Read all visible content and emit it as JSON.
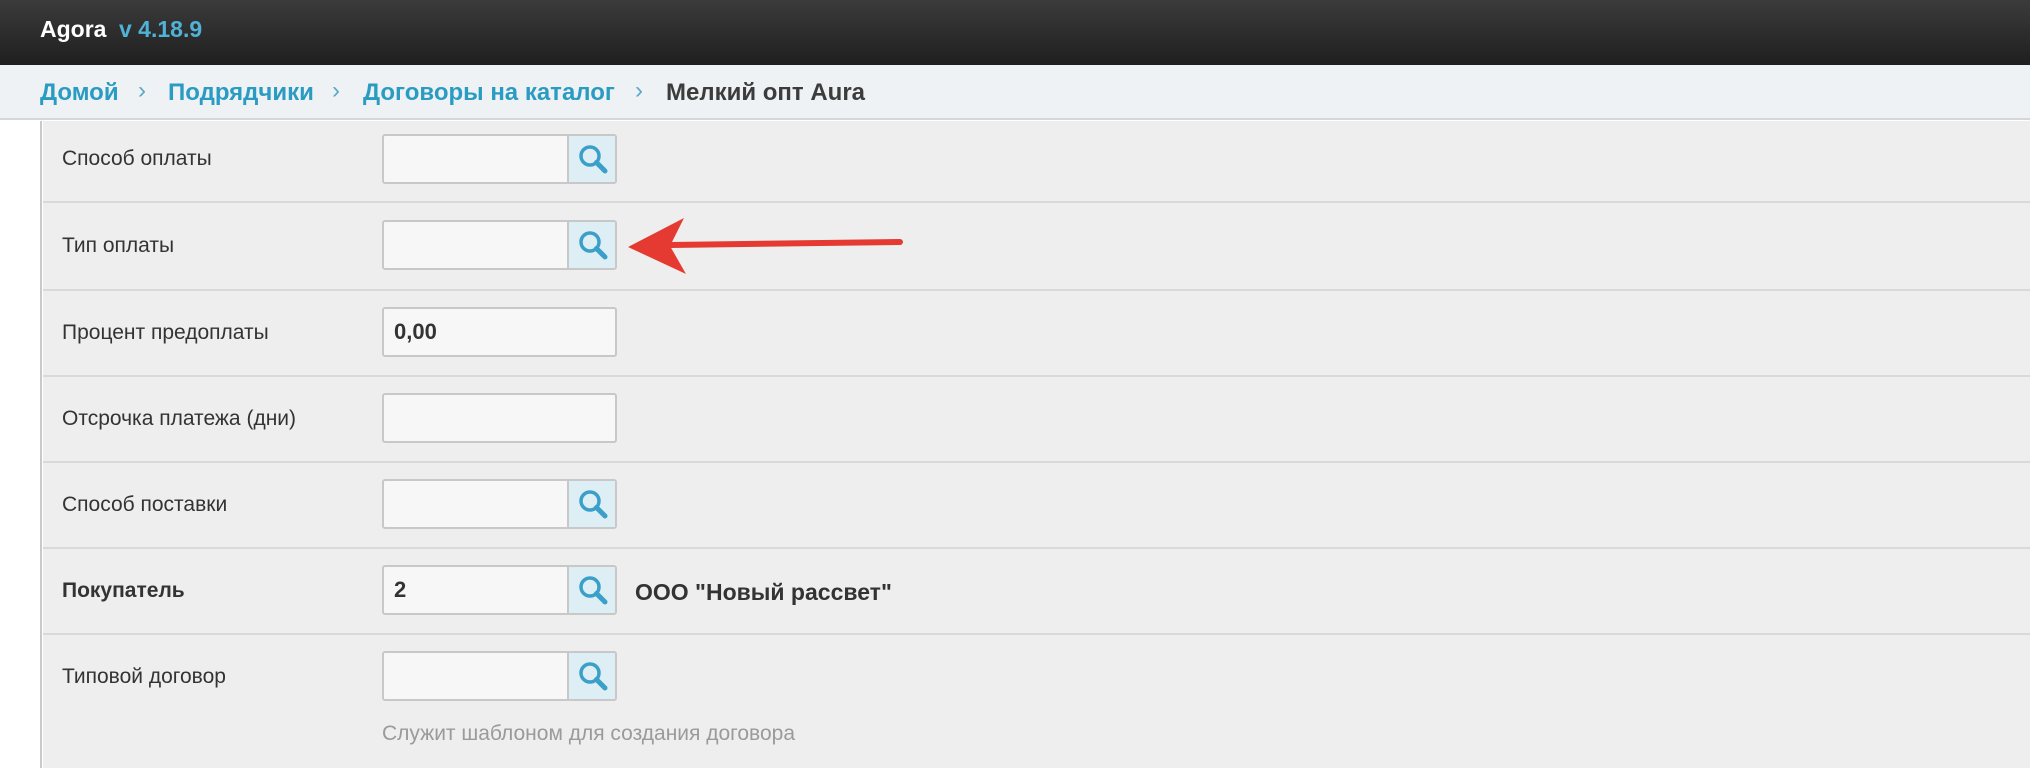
{
  "app": {
    "name": "Agora",
    "version": "v 4.18.9"
  },
  "breadcrumb": [
    {
      "label": "Домой"
    },
    {
      "label": "Подрядчики"
    },
    {
      "label": "Договоры на каталог"
    },
    {
      "label": "Мелкий опт Aura"
    }
  ],
  "form": {
    "payment_method": {
      "label": "Способ оплаты",
      "value": ""
    },
    "payment_type": {
      "label": "Тип оплаты",
      "value": ""
    },
    "prepayment_percent": {
      "label": "Процент предоплаты",
      "value": "0,00"
    },
    "payment_delay": {
      "label": "Отсрочка платежа (дни)",
      "value": ""
    },
    "delivery_method": {
      "label": "Способ поставки",
      "value": ""
    },
    "buyer": {
      "label": "Покупатель",
      "value": "2",
      "name": "ООО \"Новый рассвет\""
    },
    "template_contract": {
      "label": "Типовой договор",
      "value": "",
      "hint": "Служит шаблоном для создания договора"
    }
  },
  "icons": {
    "lookup": "magnifier-icon",
    "annotation": "red-arrow-icon"
  },
  "colors": {
    "accent": "#2a9bc2",
    "annotation": "#e53a32",
    "topbar": "#2b2b2b"
  }
}
